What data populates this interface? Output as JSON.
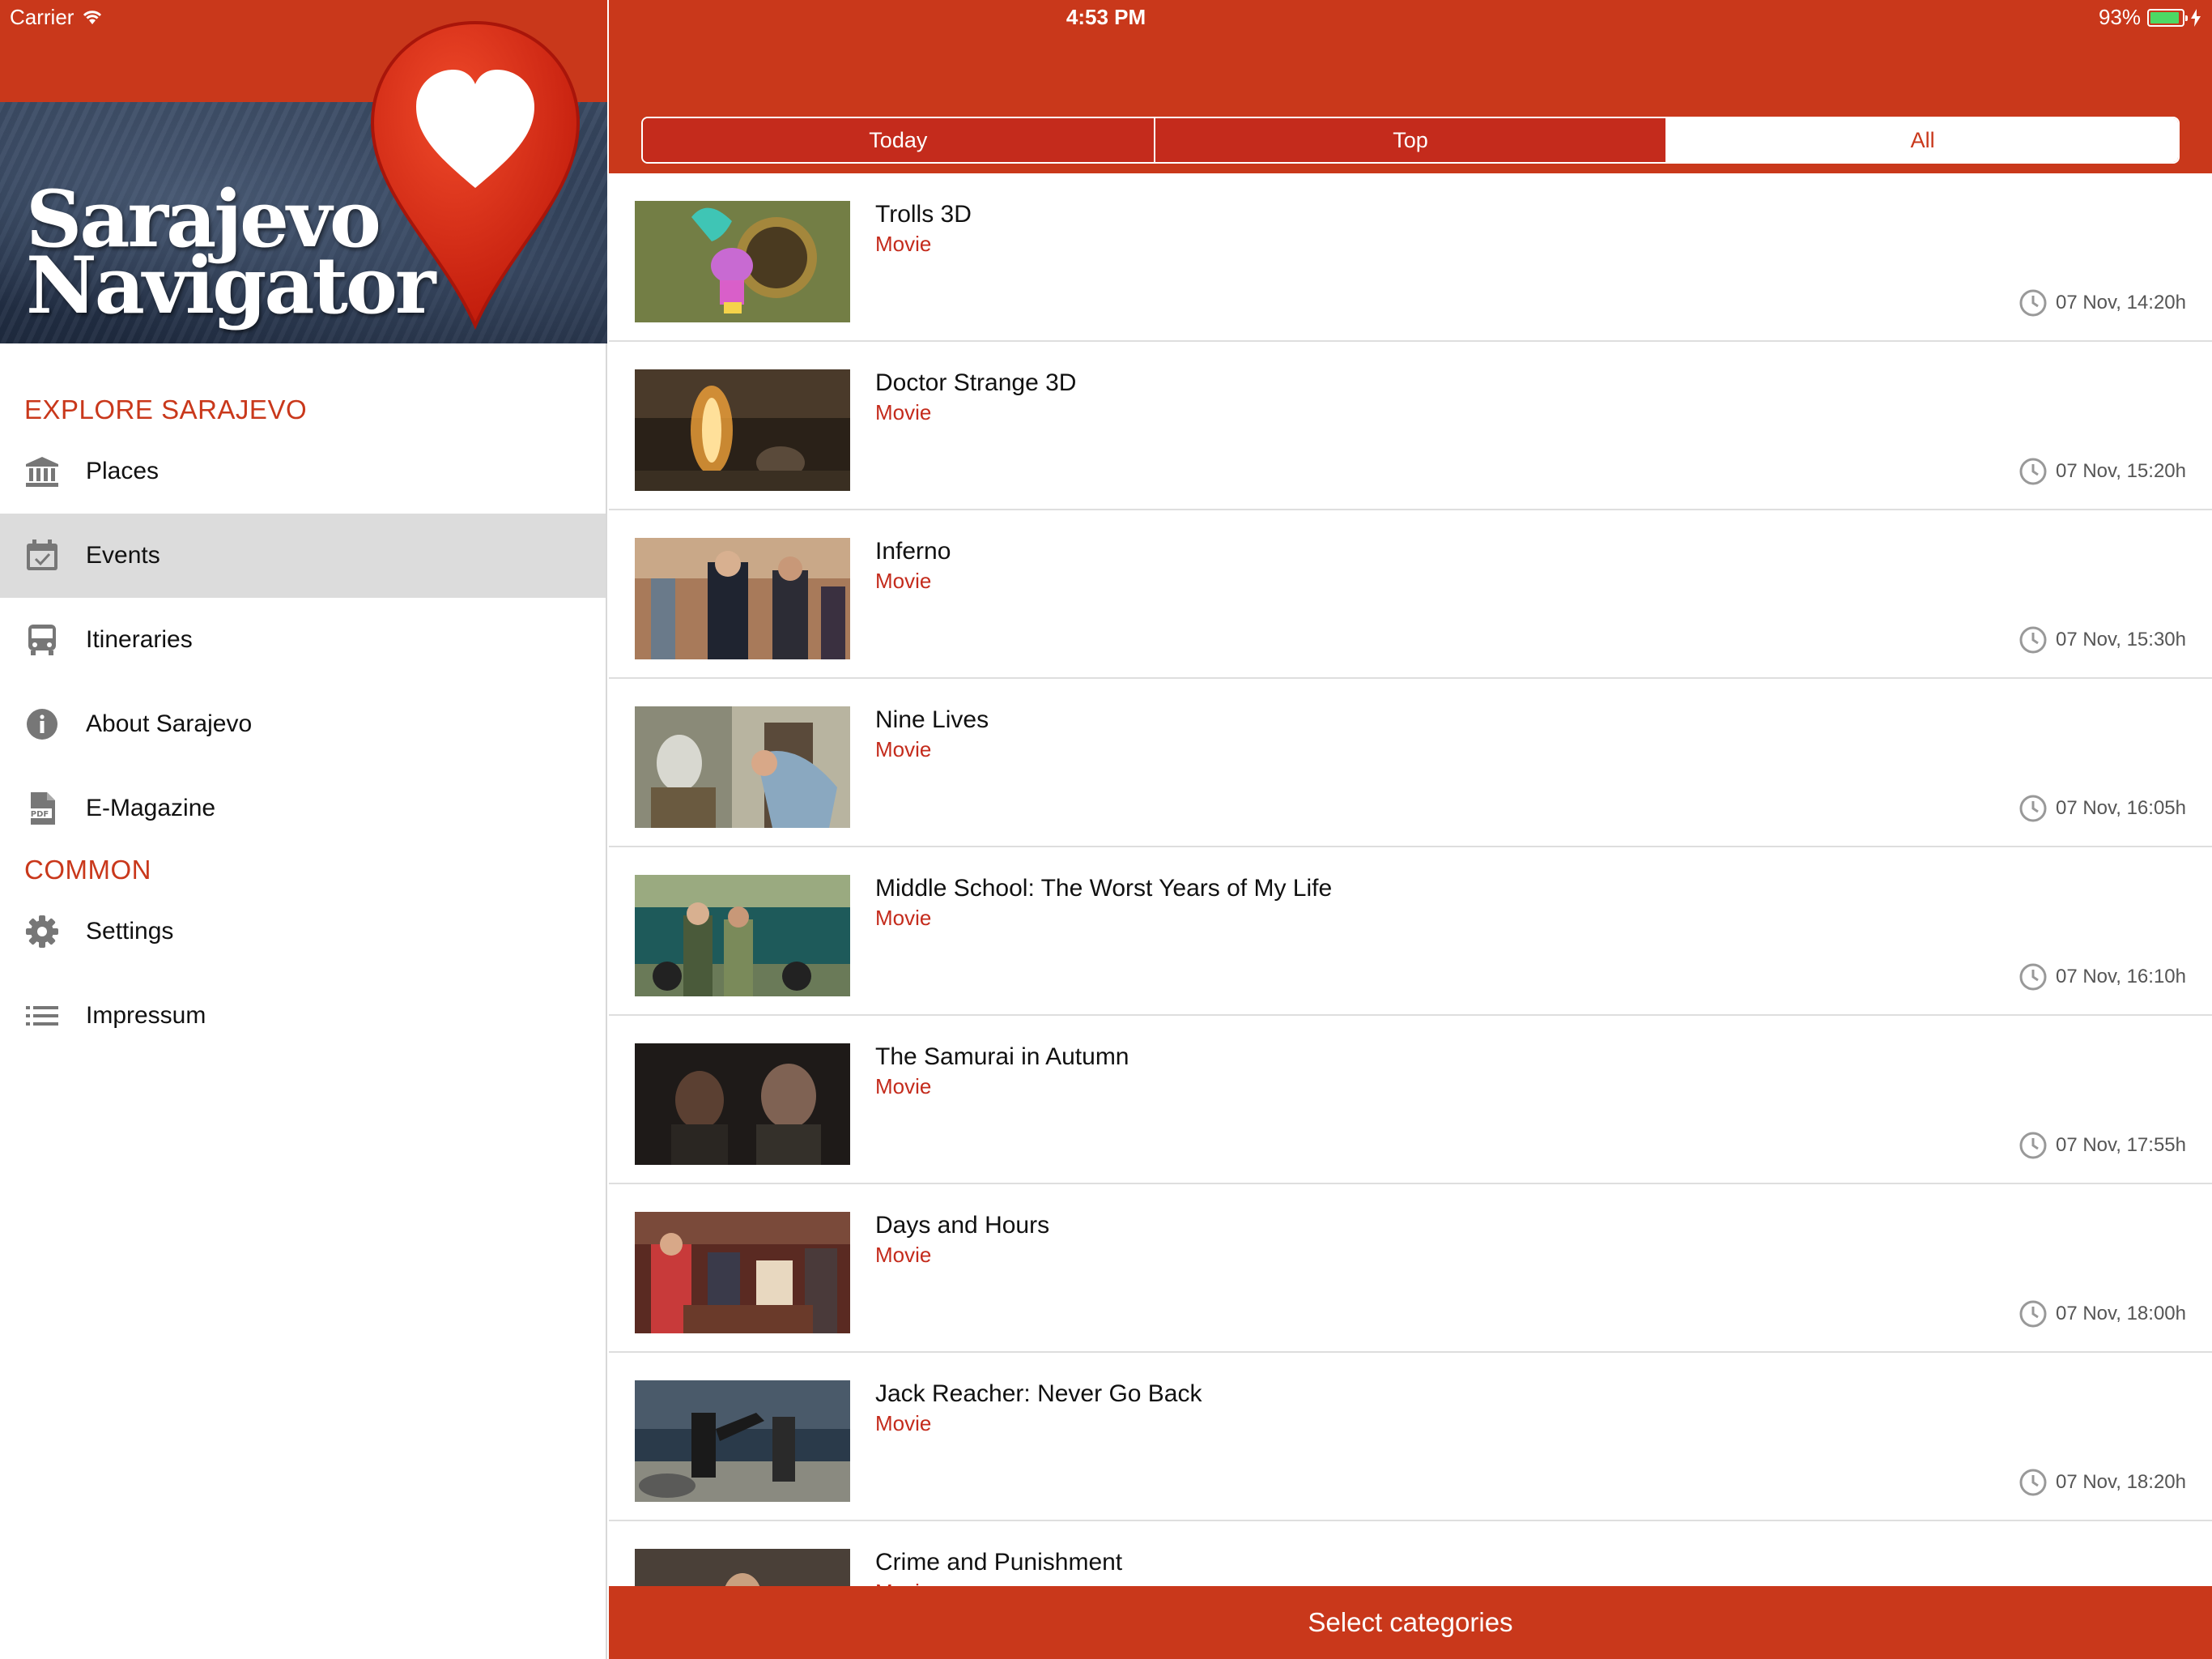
{
  "status_bar": {
    "carrier": "Carrier",
    "time": "4:53 PM",
    "battery": "93%",
    "battery_level": 0.93
  },
  "brand": {
    "logo_line1": "Sarajevo",
    "logo_line2": "Navigator",
    "accent_color": "#c9381b"
  },
  "sidebar": {
    "sections": [
      {
        "title": "EXPLORE SARAJEVO",
        "items": [
          {
            "label": "Places",
            "icon": "museum-icon"
          },
          {
            "label": "Events",
            "icon": "calendar-check-icon",
            "active": true
          },
          {
            "label": "Itineraries",
            "icon": "bus-icon"
          },
          {
            "label": "About Sarajevo",
            "icon": "info-icon"
          },
          {
            "label": "E-Magazine",
            "icon": "pdf-icon"
          }
        ]
      },
      {
        "title": "COMMON",
        "items": [
          {
            "label": "Settings",
            "icon": "gear-icon"
          },
          {
            "label": "Impressum",
            "icon": "list-icon"
          }
        ]
      }
    ]
  },
  "tabs": [
    {
      "label": "Today",
      "selected": false
    },
    {
      "label": "Top",
      "selected": false
    },
    {
      "label": "All",
      "selected": true
    }
  ],
  "events": [
    {
      "title": "Trolls 3D",
      "category": "Movie",
      "time": "07 Nov, 14:20h"
    },
    {
      "title": "Doctor Strange 3D",
      "category": "Movie",
      "time": "07 Nov, 15:20h"
    },
    {
      "title": "Inferno",
      "category": "Movie",
      "time": "07 Nov, 15:30h"
    },
    {
      "title": "Nine Lives",
      "category": "Movie",
      "time": "07 Nov, 16:05h"
    },
    {
      "title": "Middle School: The Worst Years of My Life",
      "category": "Movie",
      "time": "07 Nov, 16:10h"
    },
    {
      "title": "The Samurai in Autumn",
      "category": "Movie",
      "time": "07 Nov, 17:55h"
    },
    {
      "title": "Days and Hours",
      "category": "Movie",
      "time": "07 Nov, 18:00h"
    },
    {
      "title": "Jack Reacher: Never Go Back",
      "category": "Movie",
      "time": "07 Nov, 18:20h"
    },
    {
      "title": "Crime and Punishment",
      "category": "Movie",
      "time": ""
    }
  ],
  "bottom_bar": {
    "label": "Select categories"
  }
}
